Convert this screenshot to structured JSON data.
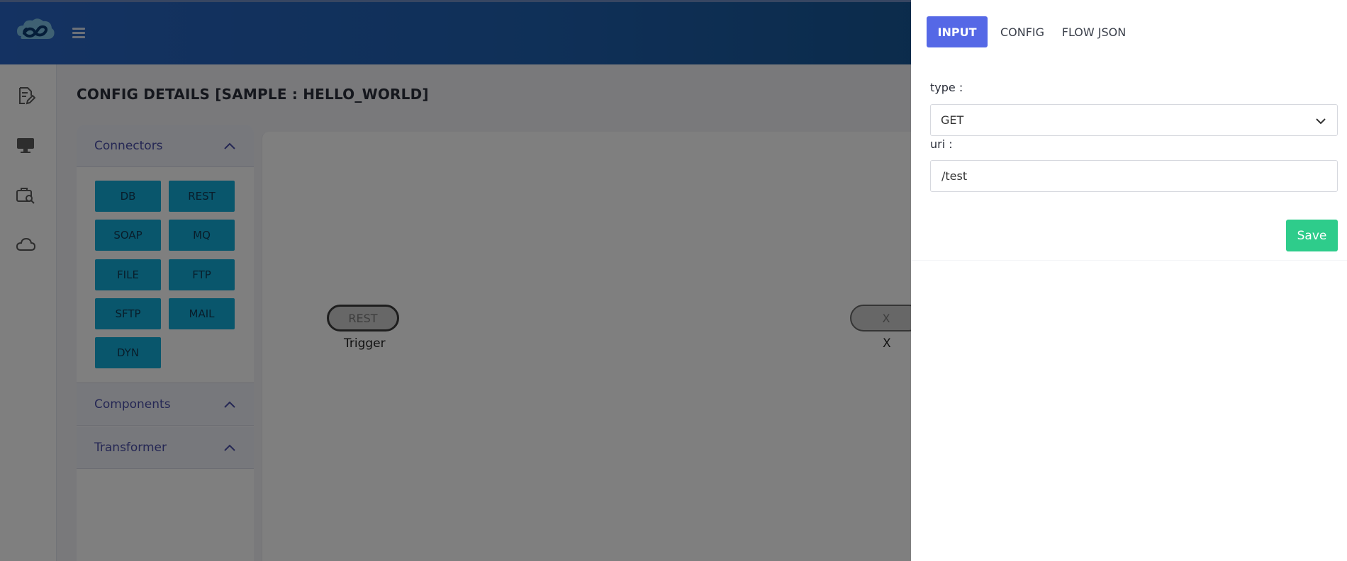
{
  "header": {
    "logo_icon": "infinity-cloud-logo",
    "menu_icon": "hamburger-icon"
  },
  "sidebar": {
    "icons": [
      "edit-document-icon",
      "monitor-icon",
      "briefcase-search-icon",
      "cloud-icon"
    ]
  },
  "page": {
    "title": "CONFIG DETAILS [SAMPLE : HELLO_WORLD]"
  },
  "panel": {
    "connectors_label": "Connectors",
    "components_label": "Components",
    "transformer_label": "Transformer",
    "connectors": [
      "DB",
      "REST",
      "SOAP",
      "MQ",
      "FILE",
      "FTP",
      "SFTP",
      "MAIL",
      "DYN"
    ]
  },
  "canvas": {
    "node1": {
      "text": "REST",
      "label": "Trigger"
    },
    "node2": {
      "text": "X",
      "label": "X"
    }
  },
  "drawer": {
    "tabs": [
      "INPUT",
      "CONFIG",
      "FLOW JSON"
    ],
    "active_tab": "INPUT",
    "type_label": "type :",
    "type_value": "GET",
    "uri_label": "uri :",
    "uri_value": "/test",
    "save_label": "Save"
  },
  "colors": {
    "header_gradient_start": "#2965c4",
    "header_gradient_end": "#0e4d7a",
    "connector_button": "#12acd9",
    "active_tab": "#5568e6",
    "save_button": "#2ecc8b",
    "accordion_label": "#4a4fa8"
  }
}
